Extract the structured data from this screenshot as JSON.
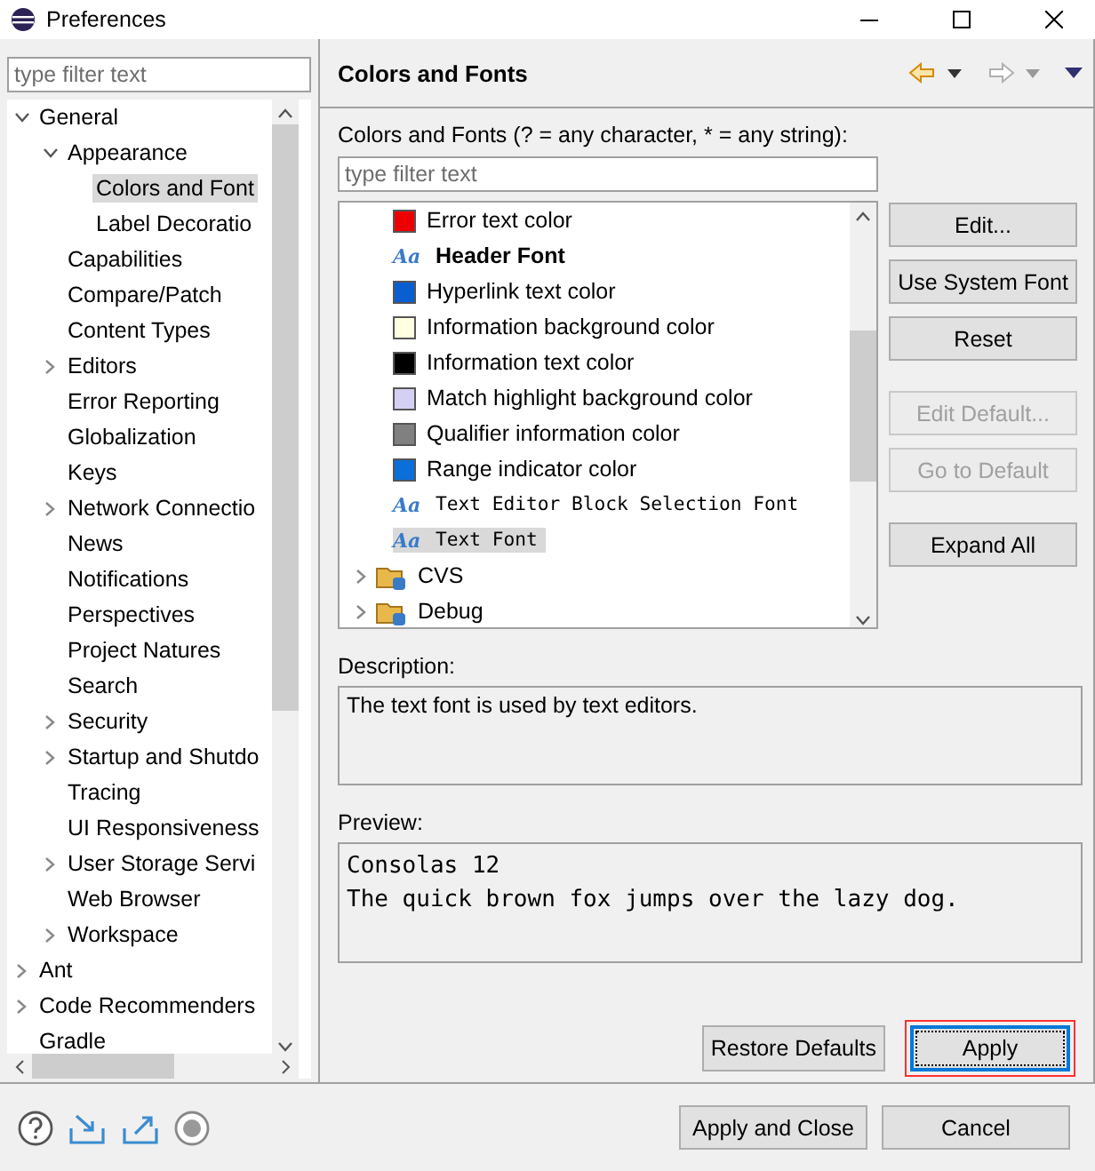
{
  "window": {
    "title": "Preferences"
  },
  "sidebar": {
    "filter": {
      "placeholder": "type filter text"
    },
    "tree": [
      {
        "label": "General",
        "expanded": true,
        "selected": false,
        "children": [
          {
            "label": "Appearance",
            "expanded": true,
            "selected": false,
            "children": [
              {
                "label": "Colors and Font",
                "selected": true
              },
              {
                "label": "Label Decoratio",
                "selected": false
              }
            ]
          },
          {
            "label": "Capabilities",
            "selected": false
          },
          {
            "label": "Compare/Patch",
            "selected": false
          },
          {
            "label": "Content Types",
            "selected": false
          },
          {
            "label": "Editors",
            "expanded": false,
            "selected": false
          },
          {
            "label": "Error Reporting",
            "selected": false
          },
          {
            "label": "Globalization",
            "selected": false
          },
          {
            "label": "Keys",
            "selected": false
          },
          {
            "label": "Network Connectio",
            "expanded": false,
            "selected": false
          },
          {
            "label": "News",
            "selected": false
          },
          {
            "label": "Notifications",
            "selected": false
          },
          {
            "label": "Perspectives",
            "selected": false
          },
          {
            "label": "Project Natures",
            "selected": false
          },
          {
            "label": "Search",
            "selected": false
          },
          {
            "label": "Security",
            "expanded": false,
            "selected": false
          },
          {
            "label": "Startup and Shutdo",
            "expanded": false,
            "selected": false
          },
          {
            "label": "Tracing",
            "selected": false
          },
          {
            "label": "UI Responsiveness",
            "selected": false
          },
          {
            "label": "User Storage Servi",
            "expanded": false,
            "selected": false
          },
          {
            "label": "Web Browser",
            "selected": false
          },
          {
            "label": "Workspace",
            "expanded": false,
            "selected": false
          }
        ]
      },
      {
        "label": "Ant",
        "expanded": false,
        "selected": false
      },
      {
        "label": "Code Recommenders",
        "expanded": false,
        "selected": false
      },
      {
        "label": "Gradle",
        "selected": false
      }
    ]
  },
  "page": {
    "title": "Colors and Fonts",
    "filter_label": "Colors and Fonts (? = any character, * = any string):",
    "filter": {
      "placeholder": "type filter text"
    },
    "items": [
      {
        "kind": "color",
        "label": "Error text color",
        "color": "#ee0000",
        "selected": false
      },
      {
        "kind": "header",
        "label": "Header Font",
        "icon": "Aa",
        "selected": false
      },
      {
        "kind": "color",
        "label": "Hyperlink text color",
        "color": "#0a5fd0",
        "selected": false
      },
      {
        "kind": "color",
        "label": "Information background color",
        "color": "#ffffe1",
        "selected": false
      },
      {
        "kind": "color",
        "label": "Information text color",
        "color": "#000000",
        "selected": false
      },
      {
        "kind": "color",
        "label": "Match highlight background color",
        "color": "#d4d0f4",
        "selected": false
      },
      {
        "kind": "color",
        "label": "Qualifier information color",
        "color": "#808080",
        "selected": false
      },
      {
        "kind": "color",
        "label": "Range indicator color",
        "color": "#0a6fd8",
        "selected": false
      },
      {
        "kind": "font",
        "label": "Text Editor Block Selection Font",
        "icon": "Aa",
        "selected": false
      },
      {
        "kind": "font",
        "label": "Text Font",
        "icon": "Aa",
        "selected": true
      },
      {
        "kind": "category",
        "label": "CVS",
        "expanded": false,
        "selected": false
      },
      {
        "kind": "category",
        "label": "Debug",
        "expanded": false,
        "selected": false
      }
    ],
    "side_buttons": [
      {
        "label": "Edit...",
        "disabled": false
      },
      {
        "label": "Use System Font",
        "disabled": false
      },
      {
        "label": "Reset",
        "disabled": false
      },
      {
        "label": "Edit Default...",
        "disabled": true
      },
      {
        "label": "Go to Default",
        "disabled": true
      },
      {
        "label": "Expand All",
        "disabled": false
      }
    ],
    "description": {
      "label": "Description:",
      "text": "The text font is used by text editors."
    },
    "preview": {
      "label": "Preview:",
      "lines": [
        "Consolas 12",
        "The quick brown fox jumps over the lazy dog."
      ]
    },
    "buttons": [
      {
        "label": "Restore Defaults",
        "default": false,
        "highlighted": false
      },
      {
        "label": "Apply",
        "default": true,
        "highlighted": true
      }
    ]
  },
  "footer": {
    "buttons": [
      {
        "label": "Apply and Close"
      },
      {
        "label": "Cancel"
      }
    ]
  }
}
